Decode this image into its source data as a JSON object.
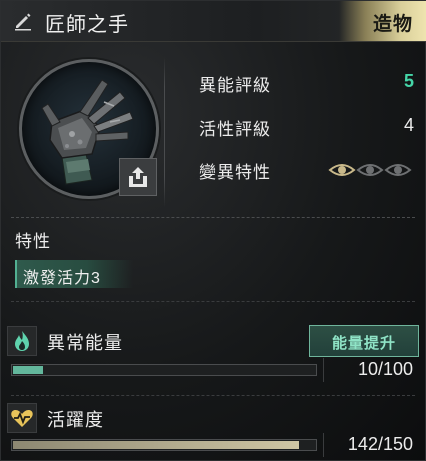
{
  "header": {
    "title": "匠師之手",
    "type_tag": "造物"
  },
  "stats": {
    "anomaly_rating": {
      "label": "異能評級",
      "value": "5"
    },
    "activity_rating": {
      "label": "活性評級",
      "value": "4"
    },
    "mutation_trait": {
      "label": "變異特性",
      "eyes_active": 1,
      "eyes_total": 3
    }
  },
  "traits": {
    "heading": "特性",
    "items": [
      "激發活力3"
    ]
  },
  "energy": {
    "label": "異常能量",
    "boost_button": "能量提升",
    "current": 10,
    "max": 100,
    "text": "10/100",
    "fill_fraction": 0.1
  },
  "activity": {
    "label": "活躍度",
    "current": 142,
    "max": 150,
    "text": "142/150",
    "fill_fraction": 0.947
  },
  "colors": {
    "accent_green": "#45d6a8",
    "energy_fill": "#63b79c",
    "activity_fill": "#cfc6a4",
    "gold_tag": "#d9cf9a"
  },
  "icons": {
    "edit": "pencil-icon",
    "share": "share-icon",
    "energy": "flame-icon",
    "activity": "heart-pulse-icon",
    "eye": "eye-icon"
  }
}
